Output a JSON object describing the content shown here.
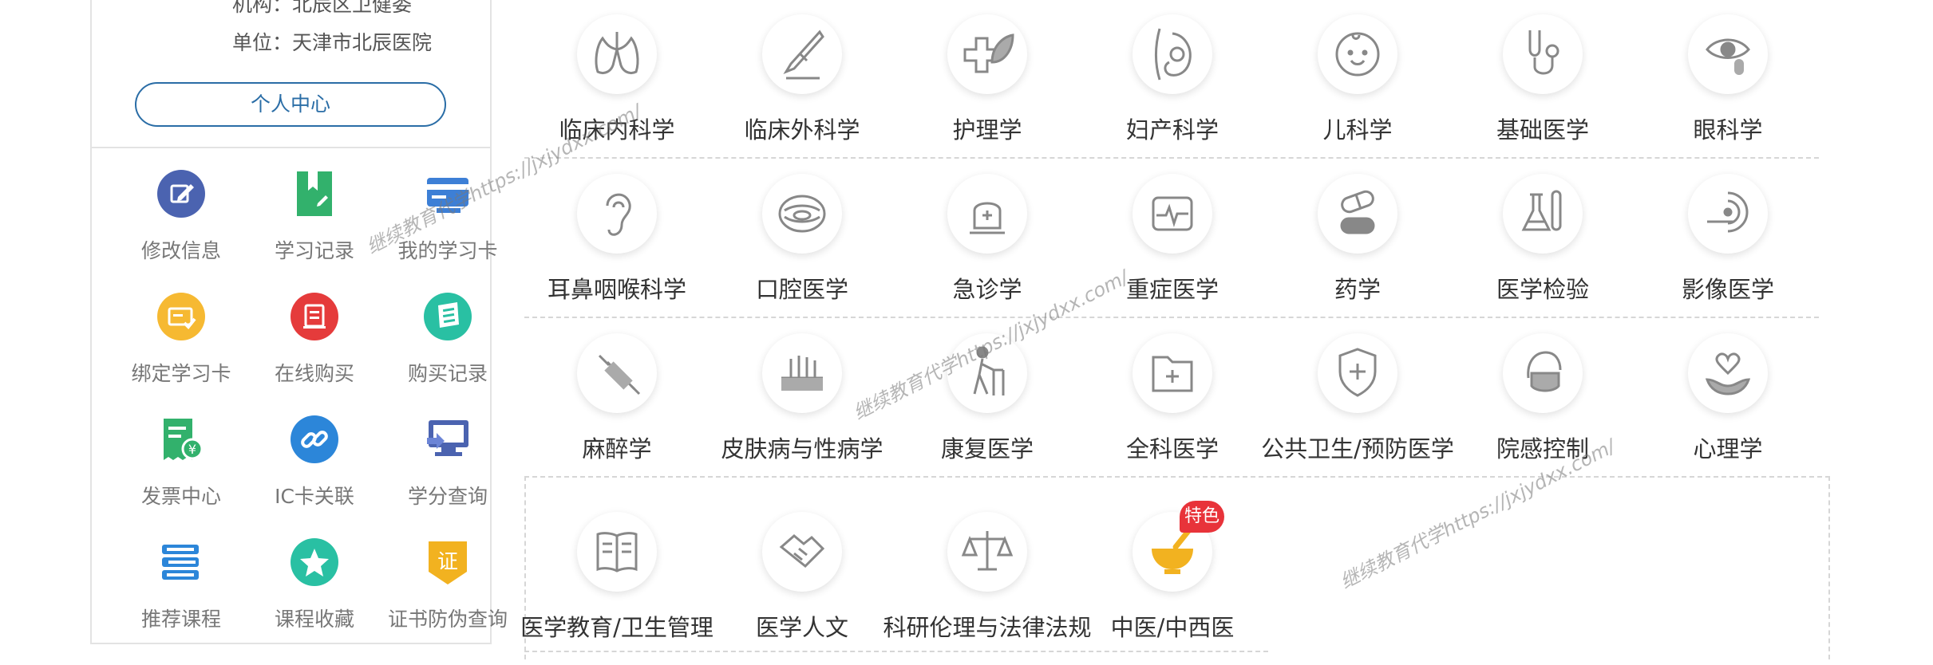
{
  "user": {
    "org_line": "机构：北辰区卫健委",
    "unit_line": "单位：天津市北辰医院",
    "center_button": "个人中心"
  },
  "menu": [
    {
      "label": "修改信息",
      "icon": "edit-icon",
      "color": "#4b63b0"
    },
    {
      "label": "学习记录",
      "icon": "bookmark-icon",
      "color": "#32b16c"
    },
    {
      "label": "我的学习卡",
      "icon": "card-icon",
      "color": "#3d7fd6"
    },
    {
      "label": "绑定学习卡",
      "icon": "bind-card-icon",
      "color": "#f6b932"
    },
    {
      "label": "在线购买",
      "icon": "cart-icon",
      "color": "#e53b3b"
    },
    {
      "label": "购买记录",
      "icon": "receipt-icon",
      "color": "#29c0a3"
    },
    {
      "label": "发票中心",
      "icon": "invoice-icon",
      "color": "#32b16c"
    },
    {
      "label": "IC卡关联",
      "icon": "link-icon",
      "color": "#2c86d9"
    },
    {
      "label": "学分查询",
      "icon": "monitor-icon",
      "color": "#4b63b0"
    },
    {
      "label": "推荐课程",
      "icon": "books-icon",
      "color": "#2c86d9"
    },
    {
      "label": "课程收藏",
      "icon": "star-icon",
      "color": "#29c0a3"
    },
    {
      "label": "证书防伪查询",
      "icon": "certificate-icon",
      "color": "#f2b220",
      "glyph": "证"
    }
  ],
  "categories": [
    {
      "label": "临床内科学",
      "icon": "lungs-icon"
    },
    {
      "label": "临床外科学",
      "icon": "scalpel-icon"
    },
    {
      "label": "护理学",
      "icon": "cross-leaf-icon"
    },
    {
      "label": "妇产科学",
      "icon": "pregnancy-icon"
    },
    {
      "label": "儿科学",
      "icon": "baby-icon"
    },
    {
      "label": "基础医学",
      "icon": "stethoscope-icon"
    },
    {
      "label": "眼科学",
      "icon": "eye-icon"
    },
    {
      "label": "耳鼻咽喉科学",
      "icon": "ear-icon"
    },
    {
      "label": "口腔医学",
      "icon": "mouth-icon"
    },
    {
      "label": "急诊学",
      "icon": "emergency-light-icon"
    },
    {
      "label": "重症医学",
      "icon": "heart-monitor-icon"
    },
    {
      "label": "药学",
      "icon": "pills-icon"
    },
    {
      "label": "医学检验",
      "icon": "lab-flask-icon"
    },
    {
      "label": "影像医学",
      "icon": "mri-icon"
    },
    {
      "label": "麻醉学",
      "icon": "syringe-icon"
    },
    {
      "label": "皮肤病与性病学",
      "icon": "skin-icon"
    },
    {
      "label": "康复医学",
      "icon": "walker-icon"
    },
    {
      "label": "全科医学",
      "icon": "medical-folder-icon"
    },
    {
      "label": "公共卫生/预防医学",
      "icon": "shield-cross-icon"
    },
    {
      "label": "院感控制",
      "icon": "mask-icon"
    },
    {
      "label": "心理学",
      "icon": "heart-hand-icon"
    },
    {
      "label": "医学教育/卫生管理",
      "icon": "book-icon"
    },
    {
      "label": "医学人文",
      "icon": "handshake-icon"
    },
    {
      "label": "科研伦理与法律法规",
      "icon": "scales-icon"
    },
    {
      "label": "中医/中西医",
      "icon": "mortar-icon",
      "badge": "特色"
    }
  ],
  "watermark": "继续教育代学https://jxjydxx.com/",
  "colors": {
    "accent": "#2a6da6",
    "badge": "#e8333a",
    "tcm": "#f2b220"
  }
}
